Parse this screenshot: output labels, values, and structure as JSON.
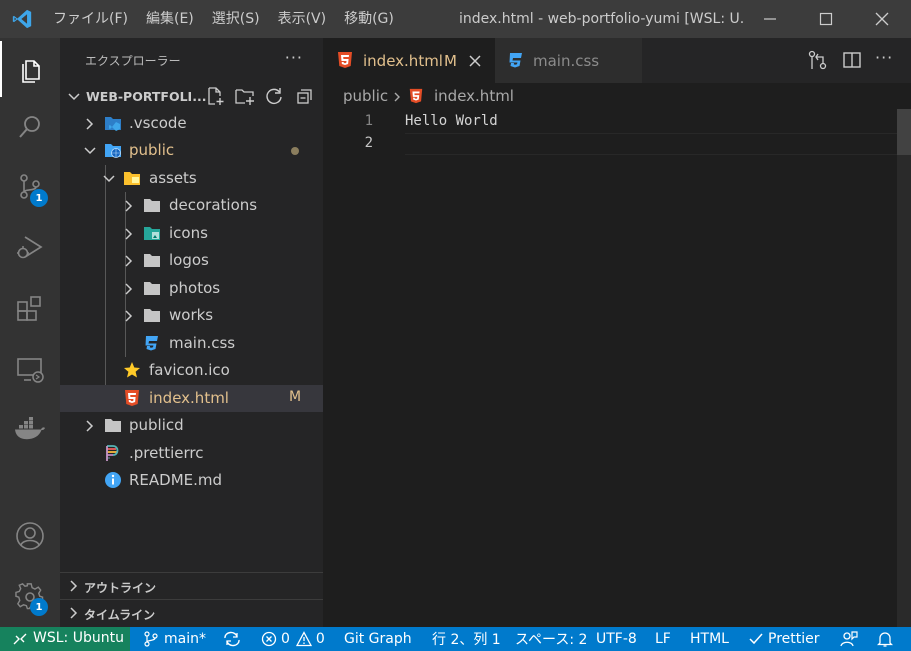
{
  "titlebar": {
    "menu": [
      "ファイル(F)",
      "編集(E)",
      "選択(S)",
      "表示(V)",
      "移動(G)"
    ],
    "window_title": "index.html - web-portfolio-yumi [WSL: U..."
  },
  "activity": {
    "scm_badge": "1",
    "settings_badge": "1"
  },
  "sidebar": {
    "title": "エクスプローラー",
    "root": "WEB-PORTFOLI...",
    "items": [
      {
        "label": ".vscode"
      },
      {
        "label": "public"
      },
      {
        "label": "assets"
      },
      {
        "label": "decorations"
      },
      {
        "label": "icons"
      },
      {
        "label": "logos"
      },
      {
        "label": "photos"
      },
      {
        "label": "works"
      },
      {
        "label": "main.css"
      },
      {
        "label": "favicon.ico"
      },
      {
        "label": "index.html",
        "decoration": "M"
      },
      {
        "label": "publicd"
      },
      {
        "label": ".prettierrc"
      },
      {
        "label": "README.md"
      }
    ],
    "outline": "アウトライン",
    "timeline": "タイムライン"
  },
  "tabs": [
    {
      "label": "index.html",
      "mark": "M"
    },
    {
      "label": "main.css"
    }
  ],
  "breadcrumb": {
    "folder": "public",
    "file": "index.html"
  },
  "editor": {
    "lines": [
      {
        "num": "1",
        "text": "Hello World"
      },
      {
        "num": "2",
        "text": ""
      }
    ]
  },
  "status": {
    "remote": "WSL: Ubuntu",
    "branch": "main*",
    "errors": "0",
    "warnings": "0",
    "git_graph": "Git Graph",
    "position": "行 2、列 1",
    "spaces": "スペース: 2",
    "encoding": "UTF-8",
    "eol": "LF",
    "language": "HTML",
    "prettier": "Prettier"
  },
  "colors": {
    "accent": "#007acc",
    "remote": "#16825d",
    "modified": "#e2c08d",
    "html": "#e44d26",
    "css": "#42a5f5",
    "folder": "#c5c5c5"
  }
}
